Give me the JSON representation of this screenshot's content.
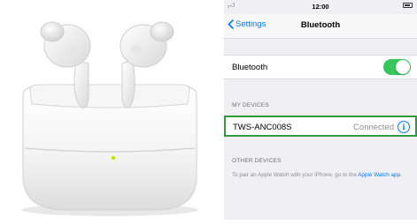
{
  "status_bar": {
    "signal": "₂₊ℐ",
    "time": "12:00",
    "right_text": "▣ℐ"
  },
  "nav": {
    "back_label": "Settings",
    "title": "Bluetooth"
  },
  "bluetooth": {
    "label": "Bluetooth",
    "toggle_on": true
  },
  "my_devices": {
    "header": "MY DEVICES",
    "devices": [
      {
        "name": "TWS-ANC008S",
        "status": "Connected"
      }
    ]
  },
  "other_devices": {
    "header": "OTHER DEVICES",
    "footnote": "To pair an Apple Watch with your iPhone, go to the ",
    "footnote_link": "Apple Watch app."
  },
  "colors": {
    "accent": "#007aff",
    "toggle": "#34c759",
    "highlight": "#2f9a3d",
    "led": "#c6e000"
  }
}
